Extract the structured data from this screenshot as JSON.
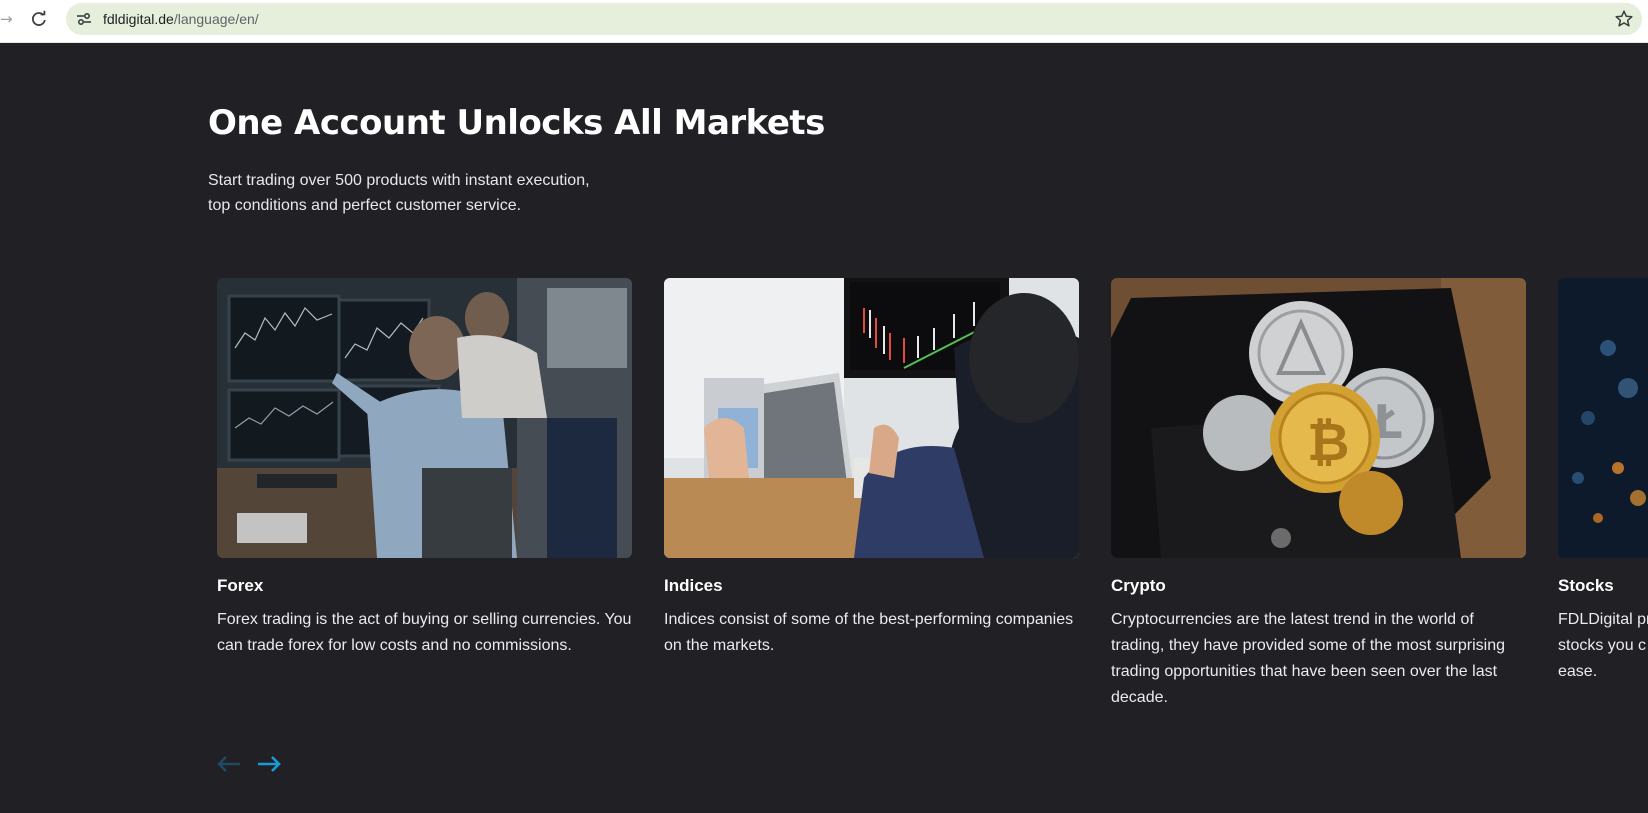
{
  "browser": {
    "url_domain": "fdldigital.de",
    "url_path": "/language/en/",
    "icons": [
      "forward-icon",
      "reload-icon",
      "site-info-icon",
      "bookmark-star-icon"
    ]
  },
  "section": {
    "title": "One Account Unlocks All Markets",
    "subtitle_line1": "Start trading over 500 products with instant execution,",
    "subtitle_line2": "top conditions and perfect customer service."
  },
  "cards": [
    {
      "title": "Forex",
      "text": "Forex trading is the act of buying or selling currencies. You can trade forex for low costs and no commissions."
    },
    {
      "title": "Indices",
      "text": "Indices consist of some of the best-performing companies on the markets."
    },
    {
      "title": "Crypto",
      "text": "Cryptocurrencies are the latest trend in the world of trading, they have provided some of the most surprising trading opportunities that have been seen over the last decade."
    },
    {
      "title": "Stocks",
      "text_line1": "FDLDigital pr",
      "text_line2": "stocks you c",
      "text_line3": "ease."
    }
  ],
  "slider": {
    "prev_icon": "arrow-left-icon",
    "next_icon": "arrow-right-icon"
  },
  "colors": {
    "background": "#202025",
    "accent": "#1b9ad6",
    "omnibox": "#e6eedc"
  }
}
